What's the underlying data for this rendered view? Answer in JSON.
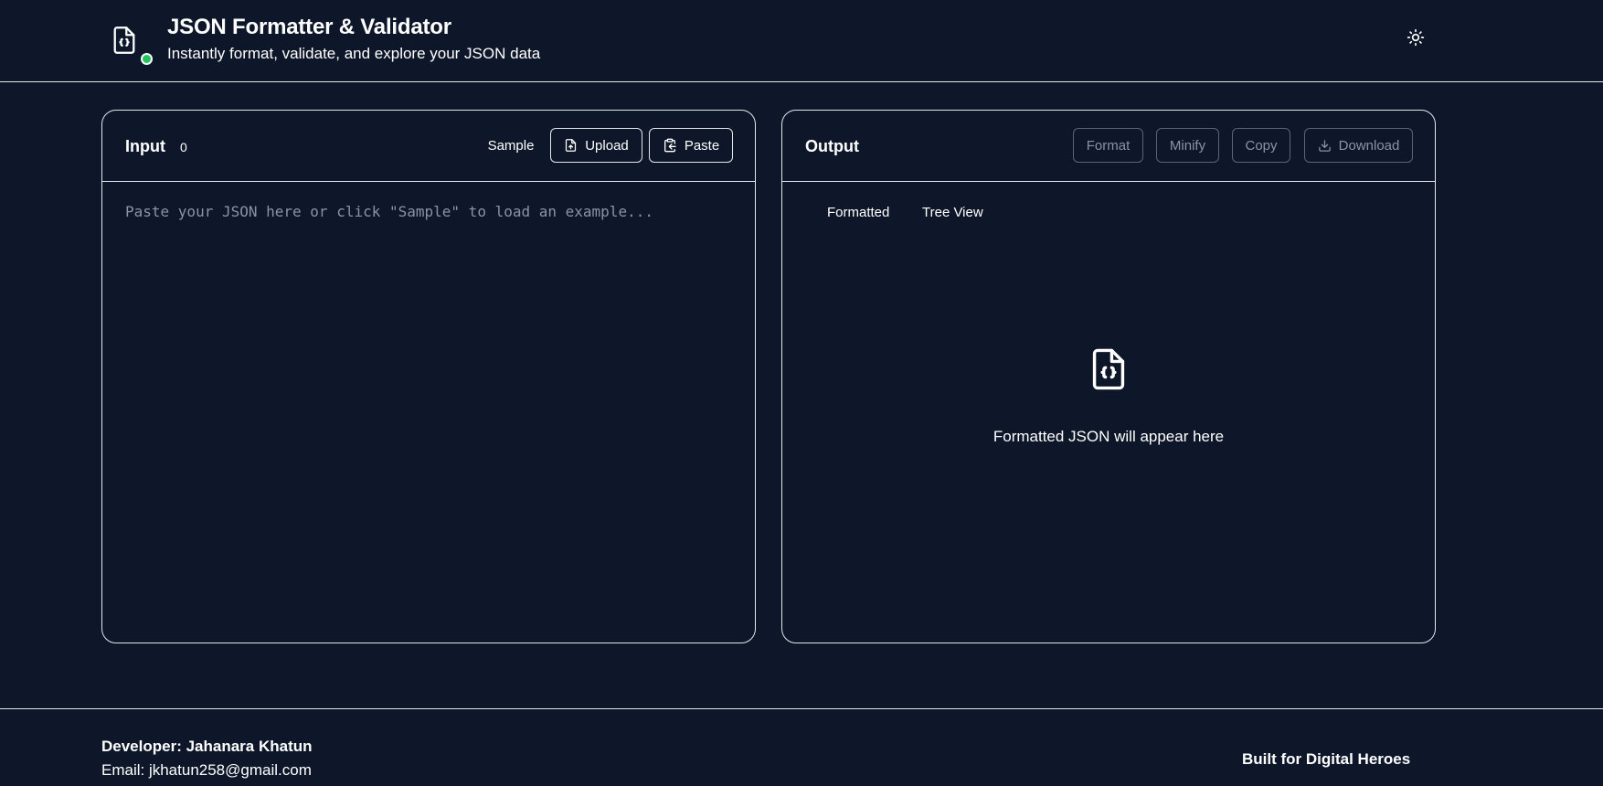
{
  "header": {
    "title": "JSON Formatter & Validator",
    "subtitle": "Instantly format, validate, and explore your JSON data",
    "logo_icon": "file-json-icon",
    "status_color": "#22c55e",
    "theme_icon": "sun-icon"
  },
  "input_panel": {
    "title": "Input",
    "char_count": "0",
    "sample_label": "Sample",
    "upload_label": "Upload",
    "paste_label": "Paste",
    "textarea_value": "",
    "textarea_placeholder": "Paste your JSON here or click \"Sample\" to load an example..."
  },
  "output_panel": {
    "title": "Output",
    "format_label": "Format",
    "minify_label": "Minify",
    "copy_label": "Copy",
    "download_label": "Download",
    "tabs": [
      {
        "label": "Formatted"
      },
      {
        "label": "Tree View"
      }
    ],
    "empty_message": "Formatted JSON will appear here"
  },
  "footer": {
    "developer": "Developer: Jahanara Khatun",
    "email": "Email: jkhatun258@gmail.com",
    "built_for": "Built for Digital Heroes"
  },
  "colors": {
    "background": "#0e172a",
    "border": "#e5e7eb",
    "muted_text": "#8b93a3"
  }
}
